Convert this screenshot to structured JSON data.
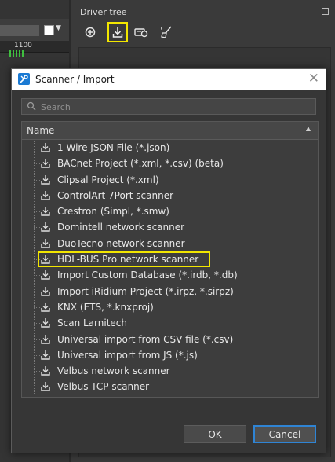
{
  "editor": {
    "ruler_label": "1100"
  },
  "panel": {
    "title": "Driver tree",
    "tools": [
      "add-icon",
      "import-icon",
      "device-icon",
      "clean-icon"
    ]
  },
  "dialog": {
    "title": "Scanner / Import",
    "search": {
      "placeholder": "Search",
      "value": ""
    },
    "column_header": "Name",
    "items": [
      {
        "label": "1-Wire JSON File (*.json)"
      },
      {
        "label": "BACnet Project (*.xml, *.csv) (beta)"
      },
      {
        "label": "Clipsal Project (*.xml)"
      },
      {
        "label": "ControlArt 7Port scanner"
      },
      {
        "label": "Crestron (Simpl, *.smw)"
      },
      {
        "label": "Domintell network scanner"
      },
      {
        "label": "DuoTecno network scanner"
      },
      {
        "label": "HDL-BUS Pro network scanner"
      },
      {
        "label": "Import Custom Database (*.irdb, *.db)"
      },
      {
        "label": "Import iRidium Project (*.irpz, *.sirpz)"
      },
      {
        "label": "KNX (ETS, *.knxproj)"
      },
      {
        "label": "Scan Larnitech"
      },
      {
        "label": "Universal import from CSV file (*.csv)"
      },
      {
        "label": "Universal import from JS (*.js)"
      },
      {
        "label": "Velbus network scanner"
      },
      {
        "label": "Velbus TCP scanner"
      }
    ],
    "ok_label": "OK",
    "cancel_label": "Cancel"
  },
  "colors": {
    "highlight": "#f2e600",
    "accent": "#2f84d4"
  }
}
